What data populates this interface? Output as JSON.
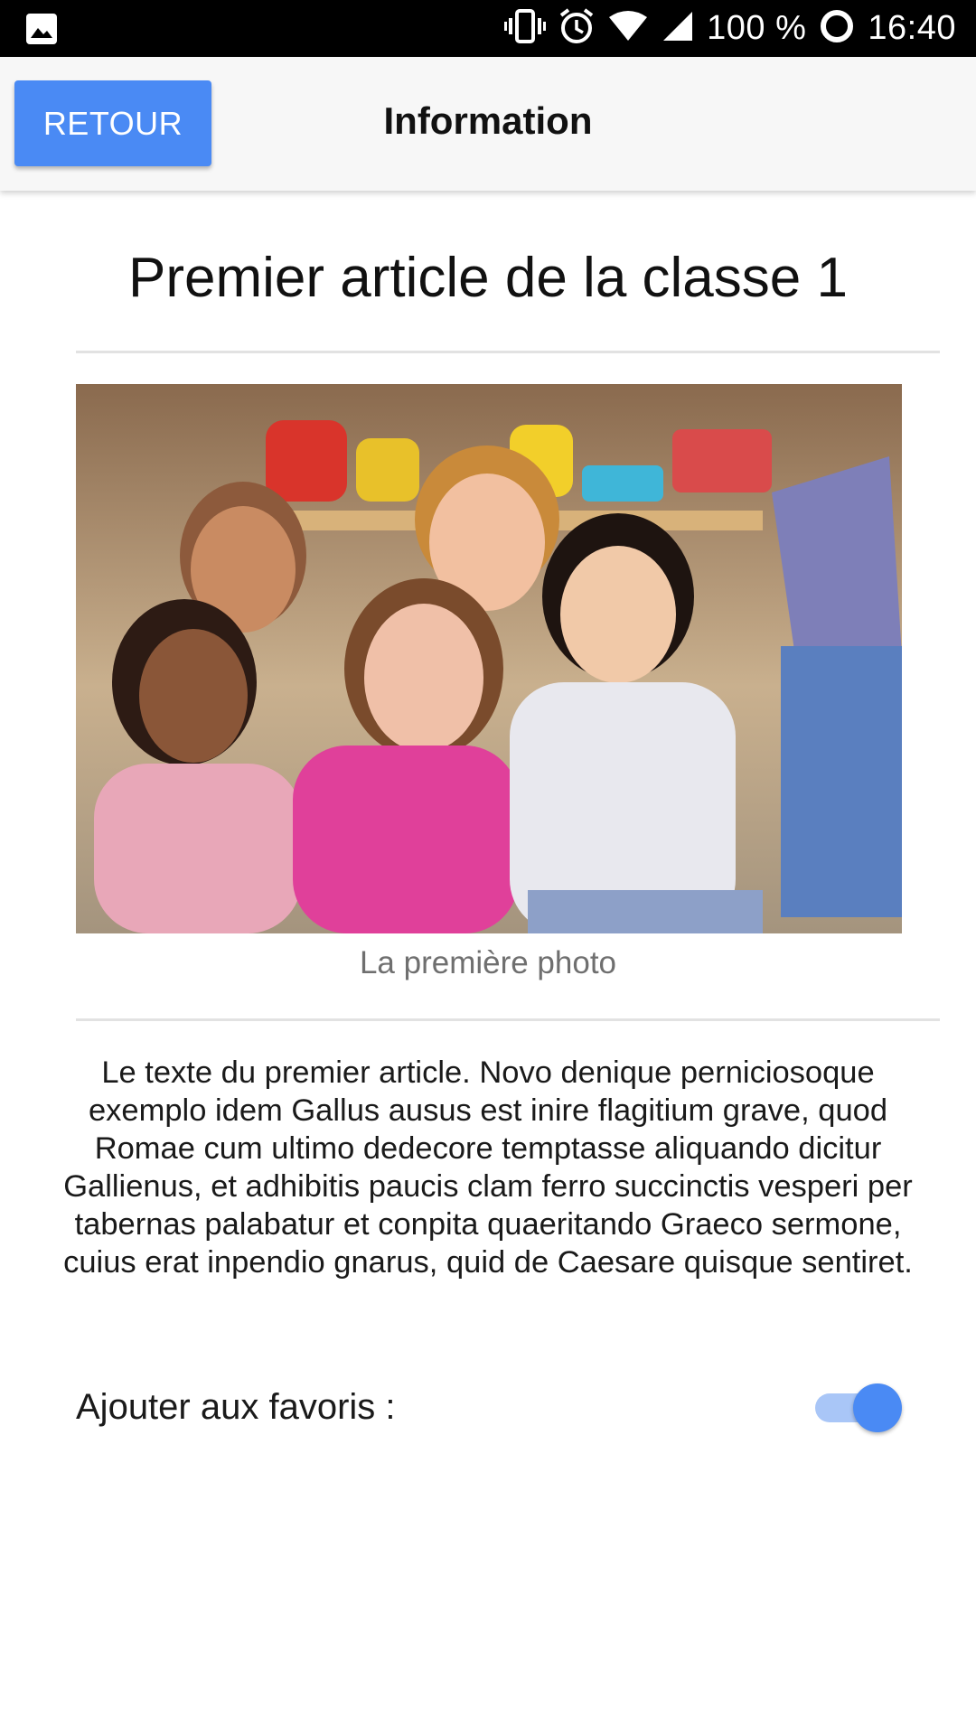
{
  "status_bar": {
    "battery": "100 %",
    "time": "16:40",
    "icons": [
      "gallery-icon",
      "vibrate-icon",
      "alarm-icon",
      "wifi-icon",
      "signal-icon",
      "battery-icon"
    ]
  },
  "app_bar": {
    "back_label": "RETOUR",
    "title": "Information"
  },
  "article": {
    "title": "Premier article de la classe 1",
    "photo_caption": "La première photo",
    "body": "Le texte du premier article. Novo denique perniciosoque exemplo idem Gallus ausus est inire flagitium grave, quod Romae cum ultimo dedecore temptasse aliquando dicitur Gallienus, et adhibitis paucis clam ferro succinctis vesperi per tabernas palabatur et conpita quaeritando Graeco sermone, cuius erat inpendio gnarus, quid de Caesare quisque sentiret."
  },
  "favorite": {
    "label": "Ajouter aux favoris :",
    "enabled": true
  },
  "colors": {
    "accent": "#4a8af4",
    "accent_track": "#a9c6f7",
    "app_bar_bg": "#f7f7f7",
    "status_bar_bg": "#000000"
  }
}
